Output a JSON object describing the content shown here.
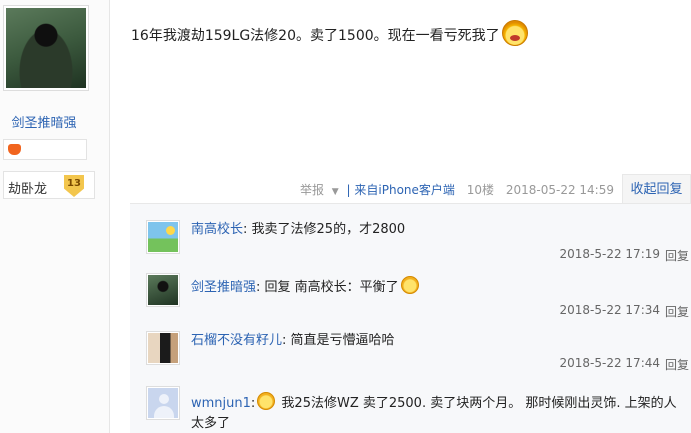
{
  "author": {
    "name": "剑圣推暗强",
    "level_title": "劫卧龙",
    "level": "13"
  },
  "post": {
    "content": "16年我渡劫159LG法修20。卖了1500。现在一看亏死我了",
    "report_label": "举报",
    "client_label": "| 来自iPhone客户端",
    "floor": "10楼",
    "time": "2018-05-22 14:59",
    "collapse_label": "收起回复"
  },
  "comments": [
    {
      "user": "南高校长",
      "sep": ":",
      "text": " 我卖了法修25的，才2800",
      "time": "2018-5-22 17:19",
      "reply": "回复"
    },
    {
      "user": "剑圣推暗强",
      "sep": ":",
      "text": " 回复 南高校长：平衡了",
      "time": "2018-5-22 17:34",
      "reply": "回复"
    },
    {
      "user": "石榴不没有籽儿",
      "sep": ":",
      "text": " 简直是亏懵逼哈哈",
      "time": "2018-5-22 17:44",
      "reply": "回复"
    },
    {
      "user": "wmnjun1",
      "sep": ":",
      "text": " 我25法修WZ 卖了2500. 卖了块两个月。 那时候刚出灵饰. 上架的人太多了"
    }
  ]
}
